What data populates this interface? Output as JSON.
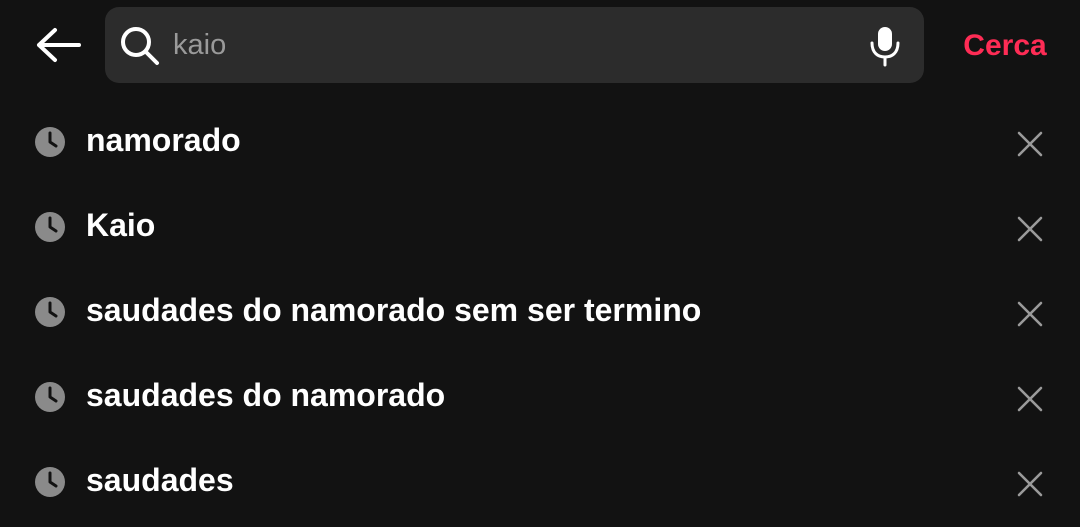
{
  "header": {
    "back_icon": "arrow-left-icon",
    "search": {
      "icon": "search-icon",
      "value": "kaio",
      "placeholder": ""
    },
    "mic_icon": "microphone-icon",
    "submit_label": "Cerca",
    "accent_color": "#fe2c55"
  },
  "history": {
    "item_icon": "clock-icon",
    "remove_icon": "close-icon",
    "items": [
      {
        "label": "namorado"
      },
      {
        "label": "Kaio"
      },
      {
        "label": "saudades do namorado sem ser termino"
      },
      {
        "label": "saudades do namorado"
      },
      {
        "label": "saudades"
      }
    ]
  },
  "colors": {
    "background": "#121212",
    "search_box": "#2c2c2c",
    "icon_gray": "#8a8a8a",
    "text": "#ffffff"
  }
}
